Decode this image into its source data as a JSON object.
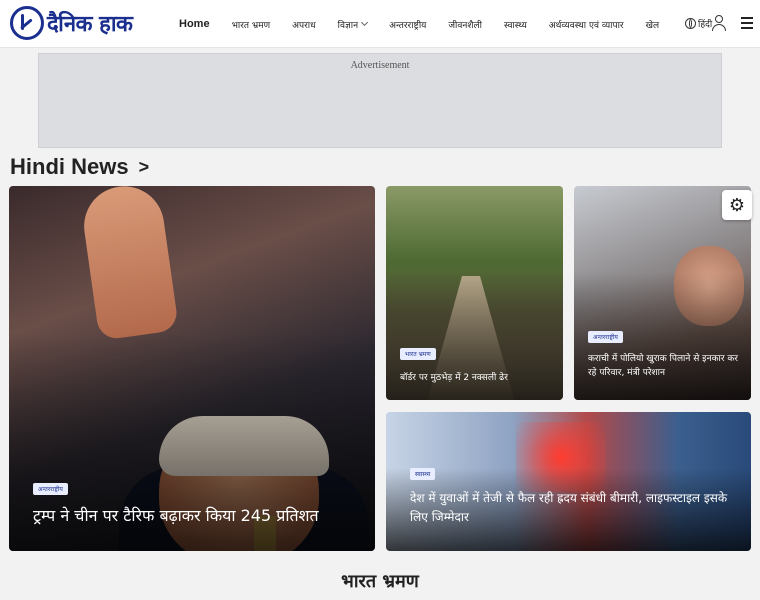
{
  "brand": {
    "logo_text": "दैनिक हाक"
  },
  "nav": {
    "items": [
      {
        "label": "Home"
      },
      {
        "label": "भारत भ्रमण"
      },
      {
        "label": "अपराध"
      },
      {
        "label": "विज्ञान"
      },
      {
        "label": "अन्तरराष्ट्रीय"
      },
      {
        "label": "जीवनशैली"
      },
      {
        "label": "स्वास्थ्य"
      },
      {
        "label": "अर्थव्यवस्था एवं व्यापार"
      },
      {
        "label": "खेल"
      }
    ],
    "language_label": "हिंदी",
    "icons": {
      "user": "user-icon",
      "menu": "hamburger-menu-icon",
      "globe": "globe-icon",
      "settings": "gear-icon"
    }
  },
  "ad": {
    "label": "Advertisement"
  },
  "section": {
    "title": "Hindi News",
    "arrow": ">"
  },
  "articles": [
    {
      "tag": "अन्तरराष्ट्रीय",
      "headline": "ट्रम्प ने चीन पर टैरिफ बढ़ाकर किया 245 प्रतिशत"
    },
    {
      "tag": "भारत भ्रमण",
      "headline": "बॉर्डर पर मुठभेड़ में 2 नक्सली ढेर"
    },
    {
      "tag": "अन्तरराष्ट्रीय",
      "headline": "कराची में पोलियो खुराक पिलाने से इनकार कर रहे परिवार, मंत्री परेशान"
    },
    {
      "tag": "स्वास्थ्य",
      "headline": "देश में युवाओं में तेजी से फैल रही ह्रदय संबंधी बीमारी, लाइफस्टाइल इसके लिए जिम्मेदार"
    }
  ],
  "next_section": {
    "title": "भारत भ्रमण"
  },
  "colors": {
    "brand": "#1b2f8f",
    "tag_bg": "#e8eeff",
    "page_bg": "#f2f2f2"
  }
}
